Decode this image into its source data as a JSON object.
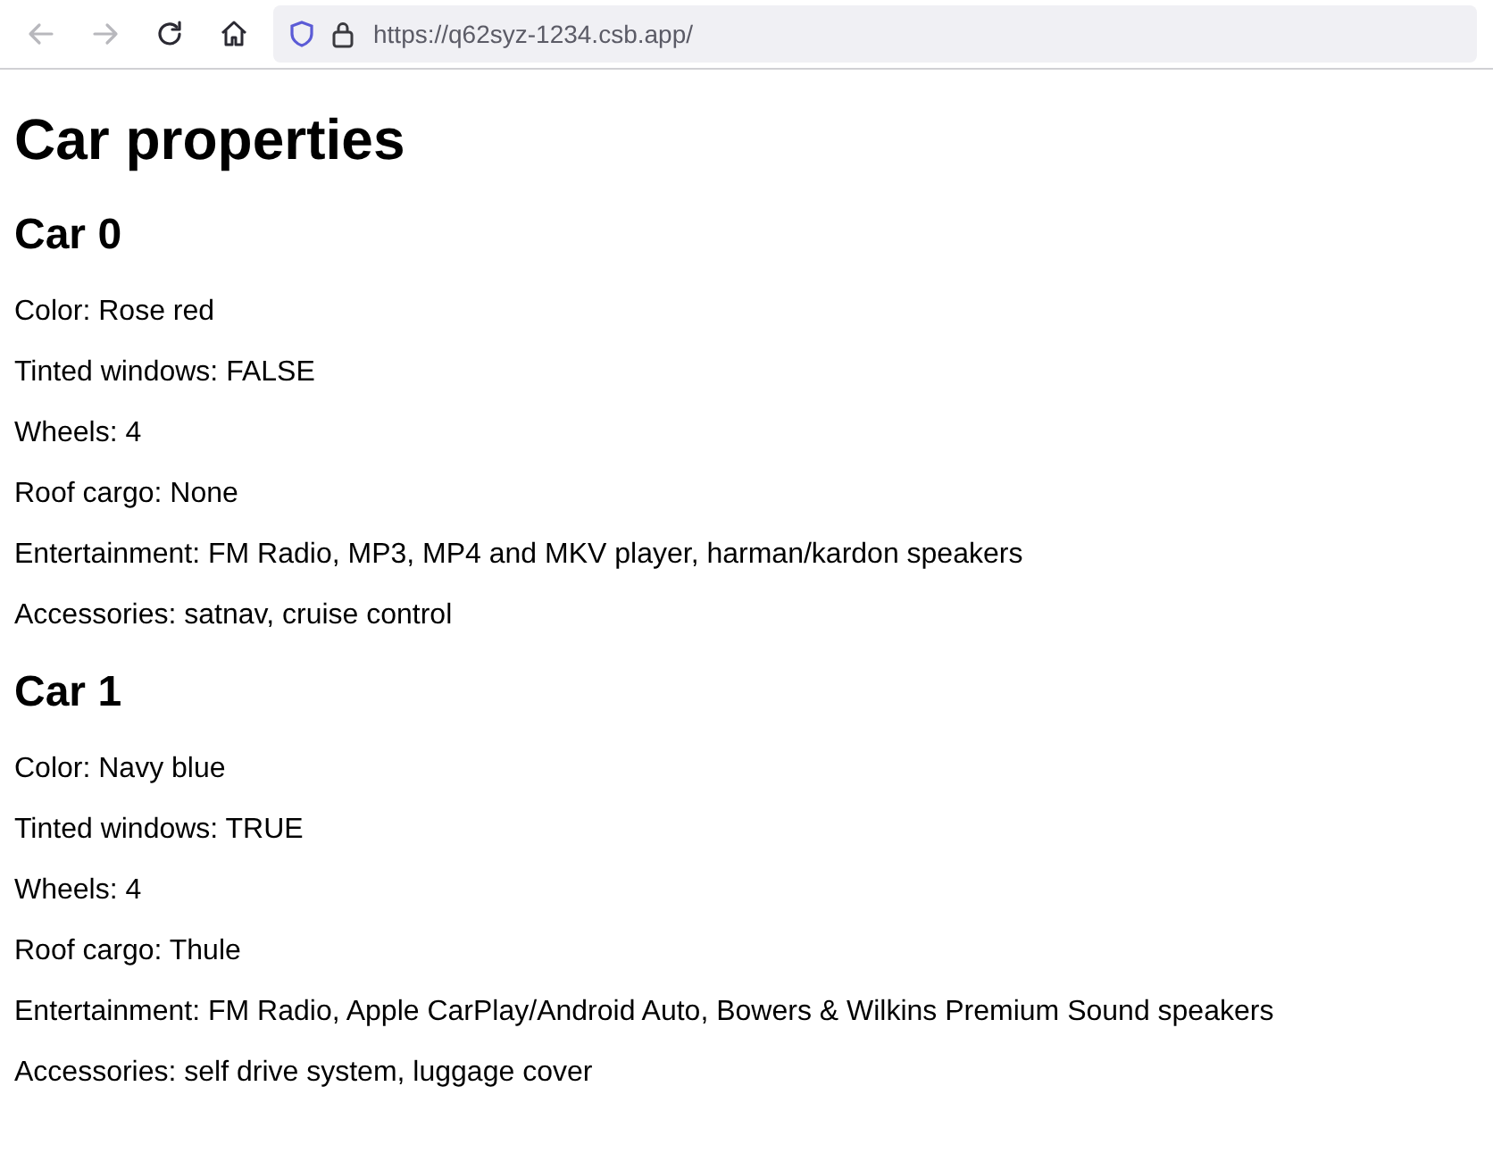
{
  "toolbar": {
    "buttons": [
      {
        "kind": "back",
        "disabled": true
      },
      {
        "kind": "forward",
        "disabled": true
      },
      {
        "kind": "reload",
        "disabled": false
      },
      {
        "kind": "home",
        "disabled": false
      }
    ],
    "url": "https://q62syz-1234.csb.app/"
  },
  "page": {
    "title": "Car properties",
    "cars": [
      {
        "heading": "Car 0",
        "properties": [
          "Color: Rose red",
          "Tinted windows: FALSE",
          "Wheels: 4",
          "Roof cargo: None",
          "Entertainment: FM Radio, MP3, MP4 and MKV player, harman/kardon speakers",
          "Accessories: satnav, cruise control"
        ]
      },
      {
        "heading": "Car 1",
        "properties": [
          "Color: Navy blue",
          "Tinted windows: TRUE",
          "Wheels: 4",
          "Roof cargo: Thule",
          "Entertainment: FM Radio, Apple CarPlay/Android Auto, Bowers & Wilkins Premium Sound speakers",
          "Accessories: self drive system, luggage cover"
        ]
      }
    ]
  }
}
